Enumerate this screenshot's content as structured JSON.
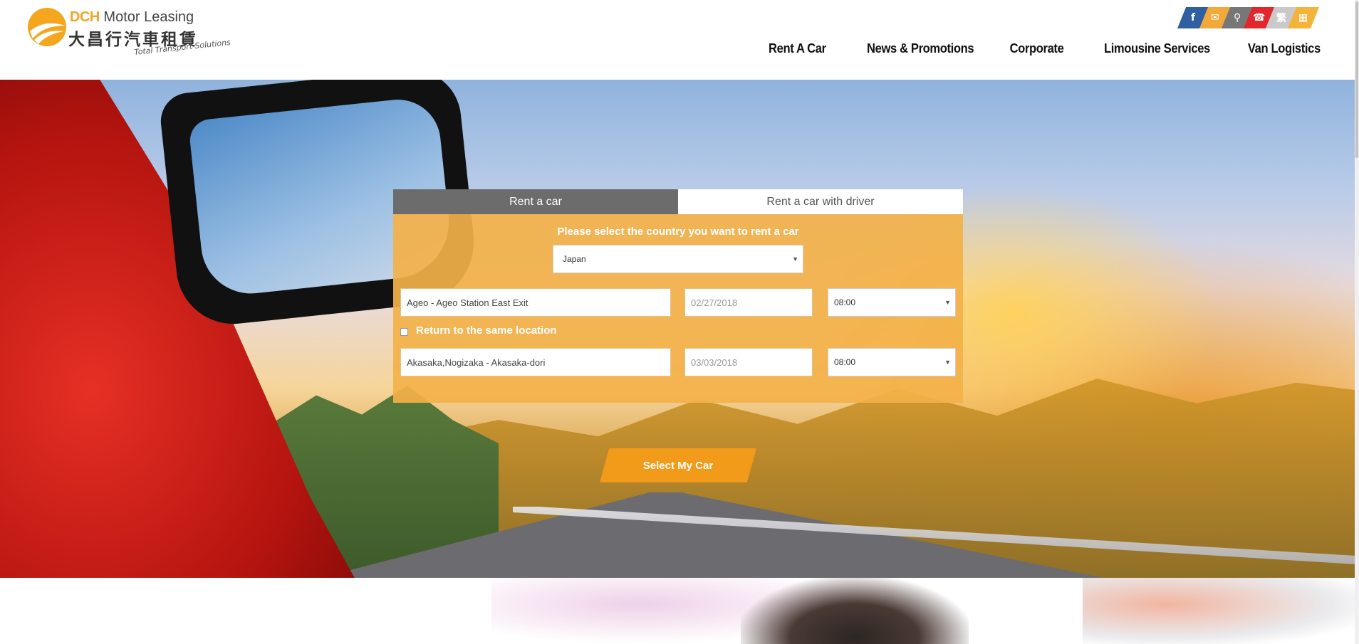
{
  "brand": {
    "name_en_bold": "DCH",
    "name_en": "Motor Leasing",
    "name_cn": "大昌行汽車租賃",
    "tagline": "Total Transport Solutions"
  },
  "social": [
    {
      "icon": "facebook-icon",
      "glyph": "f",
      "color": "#2f5ea1"
    },
    {
      "icon": "mail-icon",
      "glyph": "✉",
      "color": "#f2a93b"
    },
    {
      "icon": "search-icon",
      "glyph": "⚲",
      "color": "#777777"
    },
    {
      "icon": "phone-icon",
      "glyph": "☎",
      "color": "#e1272c"
    },
    {
      "icon": "language-icon",
      "glyph": "繁",
      "color": "#c9c9c9"
    },
    {
      "icon": "grid-icon",
      "glyph": "▦",
      "color": "#f4b43b"
    }
  ],
  "nav": {
    "items": [
      "Rent A Car",
      "News & Promotions",
      "Corporate",
      "Limousine Services",
      "Van Logistics"
    ]
  },
  "booking": {
    "tab_rent": "Rent a car",
    "tab_driver": "Rent a car with driver",
    "country_label": "Please select the country you want to rent a car",
    "country_value": "Japan",
    "pickup_location": "Ageo - Ageo Station East Exit",
    "pickup_date": "02/27/2018",
    "pickup_time": "08:00",
    "return_same_label": "Return to the same location",
    "return_location": "Akasaka,Nogizaka - Akasaka-dori",
    "return_date": "03/03/2018",
    "return_time": "08:00",
    "cta": "Select My Car"
  },
  "colors": {
    "accent": "#f29a1a",
    "panel": "#f3b149",
    "tab_active": "#6c6c6c"
  }
}
